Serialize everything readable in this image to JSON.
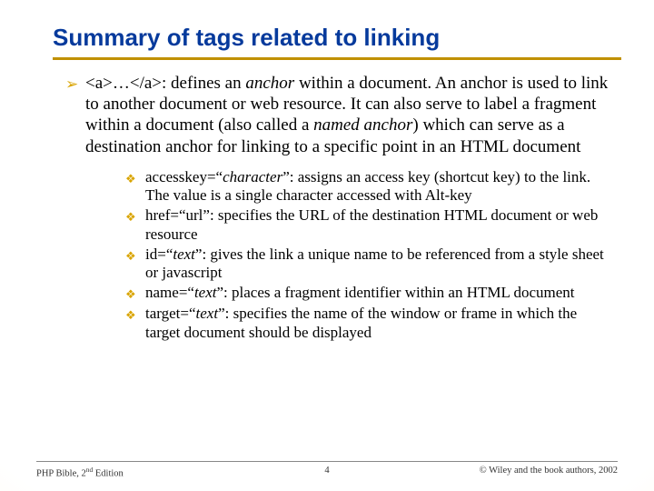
{
  "title": "Summary of tags related to linking",
  "main_bullet": {
    "tag_open": "<a>",
    "ellipsis": "…",
    "tag_close": "</a>",
    "after_tag": ": defines an ",
    "italic1": "anchor",
    "mid1": " within a document. An anchor is used to link to another document or web resource. It can also serve to label a fragment within a document (also called a ",
    "italic2": "named anchor",
    "mid2": ") which can serve as a destination anchor for linking to a specific point in an HTML document"
  },
  "sub": [
    {
      "attr": "accesskey=",
      "q1": "“",
      "ival": "character",
      "q2": "”",
      "rest": ": assigns an access key (shortcut key) to the link. The value is a single character accessed with Alt-key"
    },
    {
      "attr": "href=",
      "q1": "“",
      "ival": "",
      "plain": "url",
      "q2": "”",
      "rest": ": specifies the URL of the destination HTML document or web resource"
    },
    {
      "attr": "id=",
      "q1": "“",
      "ival": "text",
      "q2": "”",
      "rest": ": gives the link a unique name to be referenced from a style sheet or javascript"
    },
    {
      "attr": "name=",
      "q1": "“",
      "ival": "text",
      "q2": "”",
      "rest": ": places a fragment identifier within an HTML document"
    },
    {
      "attr": "target=",
      "q1": "“",
      "ival": "text",
      "q2": "”",
      "rest": ": specifies the name of the window or frame in which the target document should be displayed"
    }
  ],
  "footer": {
    "left_pre": "PHP Bible, 2",
    "left_sup": "nd",
    "left_post": " Edition",
    "page": "4",
    "right": "© Wiley and the book authors, 2002"
  },
  "chart_data": {
    "type": "table",
    "note": "no chart present"
  }
}
